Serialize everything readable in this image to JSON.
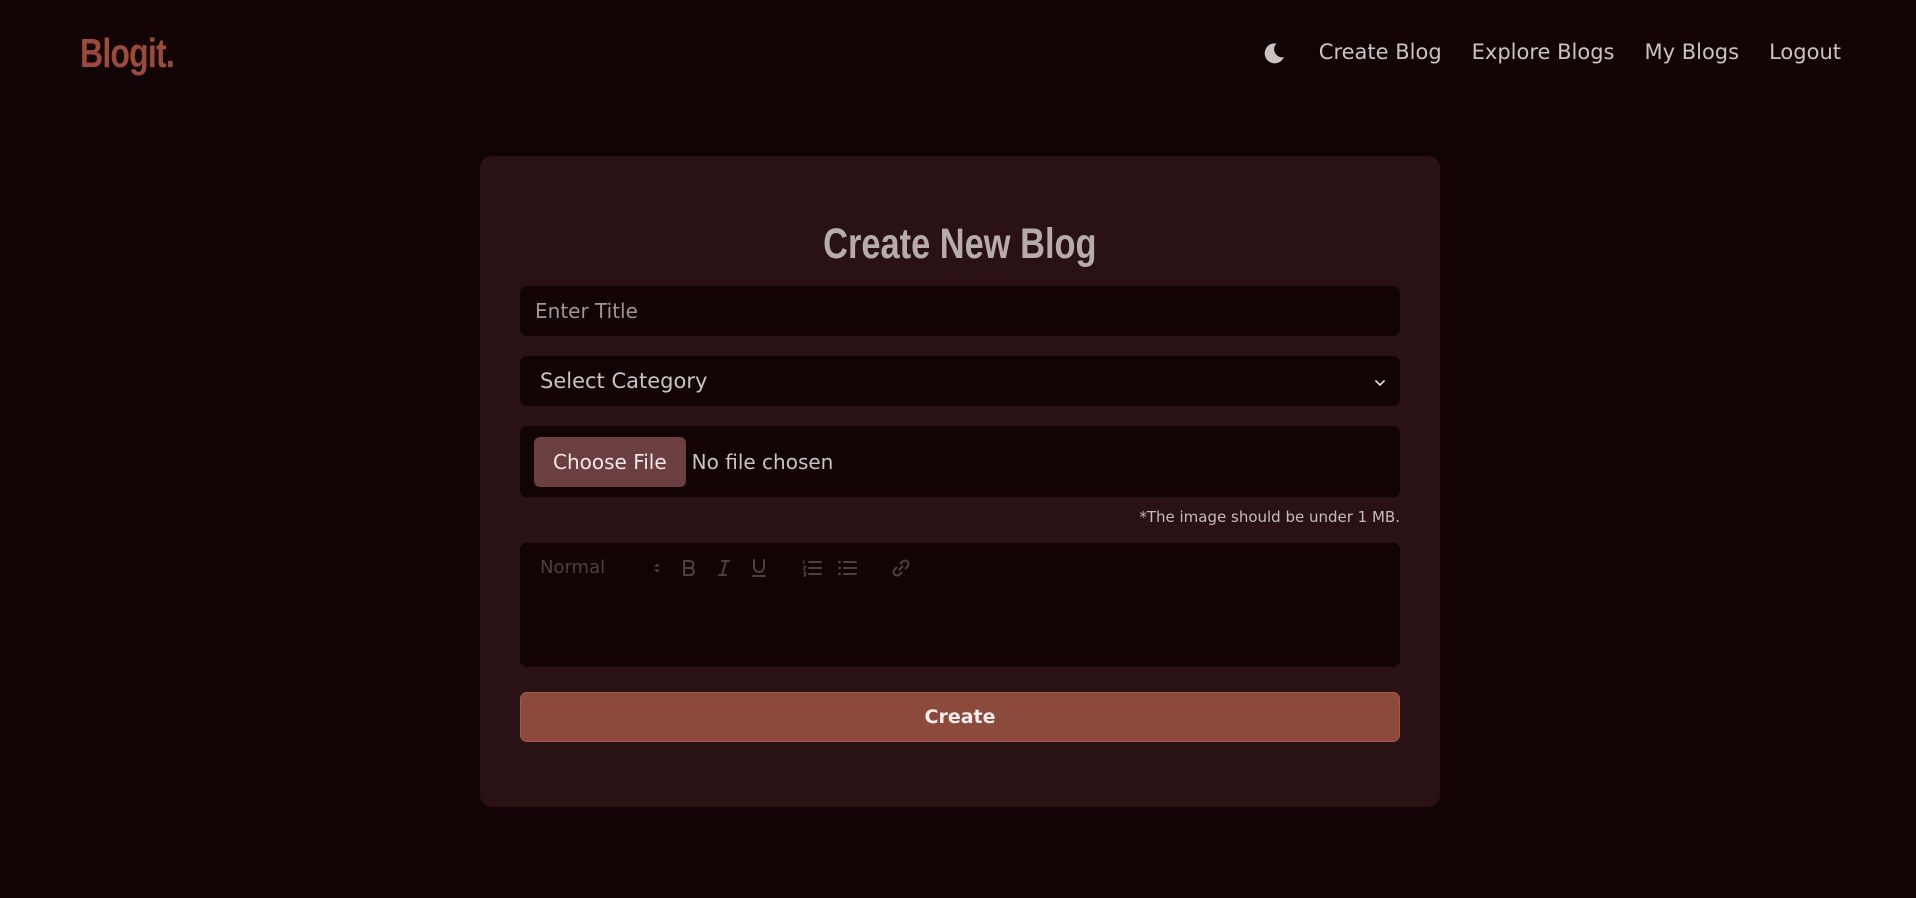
{
  "brand": {
    "logo_text": "Blogit."
  },
  "nav": {
    "theme_icon": "moon-icon",
    "links": [
      {
        "label": "Create Blog"
      },
      {
        "label": "Explore Blogs"
      },
      {
        "label": "My Blogs"
      },
      {
        "label": "Logout"
      }
    ]
  },
  "form": {
    "title": "Create New Blog",
    "title_placeholder": "Enter Title",
    "title_value": "",
    "category_selected": "Select Category",
    "file_button_label": "Choose File",
    "file_status": "No file chosen",
    "file_hint": "*The image should be under 1 MB.",
    "editor": {
      "heading_select_value": "Normal",
      "tools": [
        "bold-icon",
        "italic-icon",
        "underline-icon",
        "ordered-list-icon",
        "bullet-list-icon",
        "link-icon"
      ],
      "content": ""
    },
    "submit_label": "Create"
  },
  "colors": {
    "page_bg": "#120304",
    "card_bg": "#2a1214",
    "accent": "#8c4a3c",
    "logo": "#9b4a3d",
    "file_button": "#6b3e40"
  }
}
